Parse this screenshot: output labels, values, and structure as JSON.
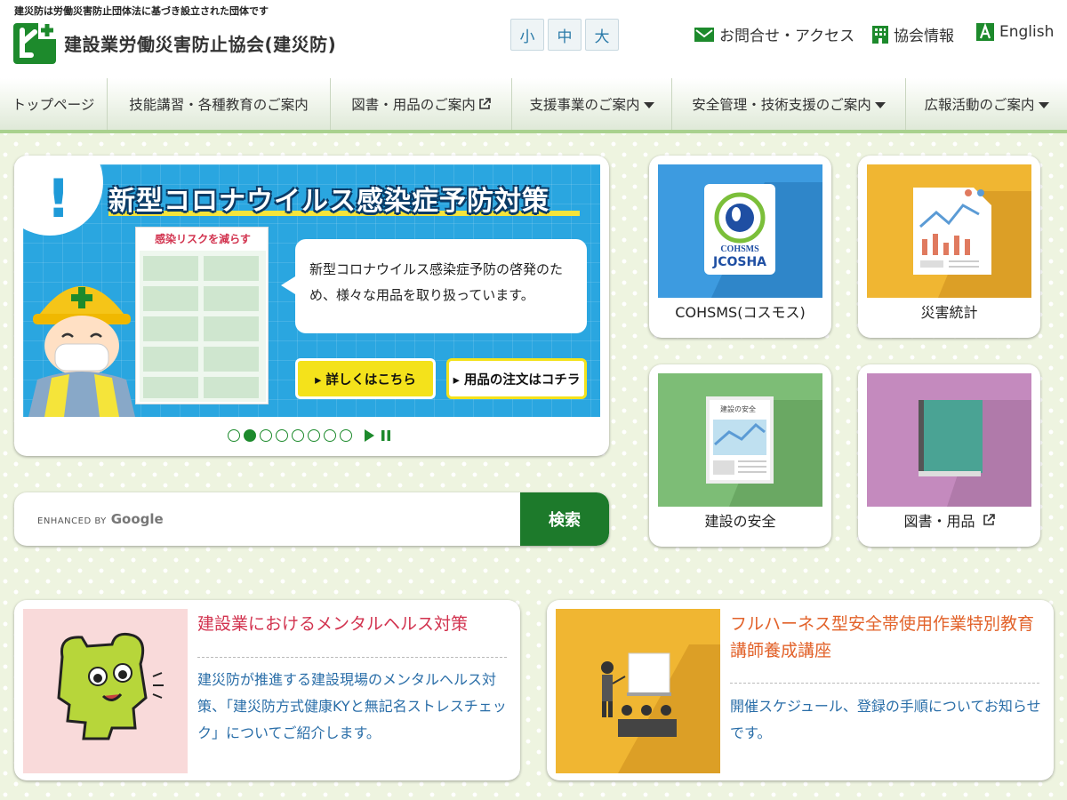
{
  "header": {
    "tagline": "建災防は労働災害防止団体法に基づき設立された団体です",
    "site_name": "建設業労働災害防止協会(建災防)",
    "font_size": [
      "小",
      "中",
      "大"
    ],
    "links": {
      "contact": "お問合せ・アクセス",
      "about": "協会情報",
      "english": "English"
    }
  },
  "nav": [
    {
      "label": "トップページ",
      "icon": ""
    },
    {
      "label": "技能講習・各種教育のご案内",
      "icon": ""
    },
    {
      "label": "図書・用品のご案内",
      "icon": "external-link-icon"
    },
    {
      "label": "支援事業のご案内",
      "icon": "caret-down-icon"
    },
    {
      "label": "安全管理・技術支援のご案内",
      "icon": "caret-down-icon"
    },
    {
      "label": "広報活動のご案内",
      "icon": "caret-down-icon"
    }
  ],
  "slider": {
    "title": "新型コロナウイルス感染症予防対策",
    "bubble": "新型コロナウイルス感染症予防の啓発のため、様々な用品を取り扱っています。",
    "btn_details": "▸ 詳しくはこちら",
    "btn_order": "▸ 用品の注文はコチラ",
    "poster_heading": "感染リスクを減らす",
    "slide_count": 8,
    "active_slide": 2
  },
  "search": {
    "enhanced_by": "ENHANCED BY",
    "google": "Google",
    "button": "検索"
  },
  "tiles": [
    {
      "label": "COHSMS(コスモス)",
      "bg": "#3d9be0",
      "badge": "COHSMS",
      "badge2": "JCOSHA"
    },
    {
      "label": "災害統計",
      "bg": "#f0b632"
    },
    {
      "label": "建設の安全",
      "bg": "#7dbd76",
      "doc_title": "建設の安全"
    },
    {
      "label": "図書・用品",
      "bg": "#c48abe"
    }
  ],
  "features": [
    {
      "title": "建設業におけるメンタルヘルス対策",
      "title_color": "#d2334f",
      "desc": "建災防が推進する建設現場のメンタルヘルス対策、「建災防方式健康KYと無記名ストレスチェック」についてご紹介します。",
      "bg": "#f9dada"
    },
    {
      "title": "フルハーネス型安全帯使用作業特別教育講師養成講座",
      "title_color": "#e2622a",
      "desc": "開催スケジュール、登録の手順についてお知らせです。",
      "bg": "#f0b632"
    }
  ],
  "colors": {
    "brand_green": "#1d7a2b",
    "nav_accent": "#a9d18e"
  }
}
